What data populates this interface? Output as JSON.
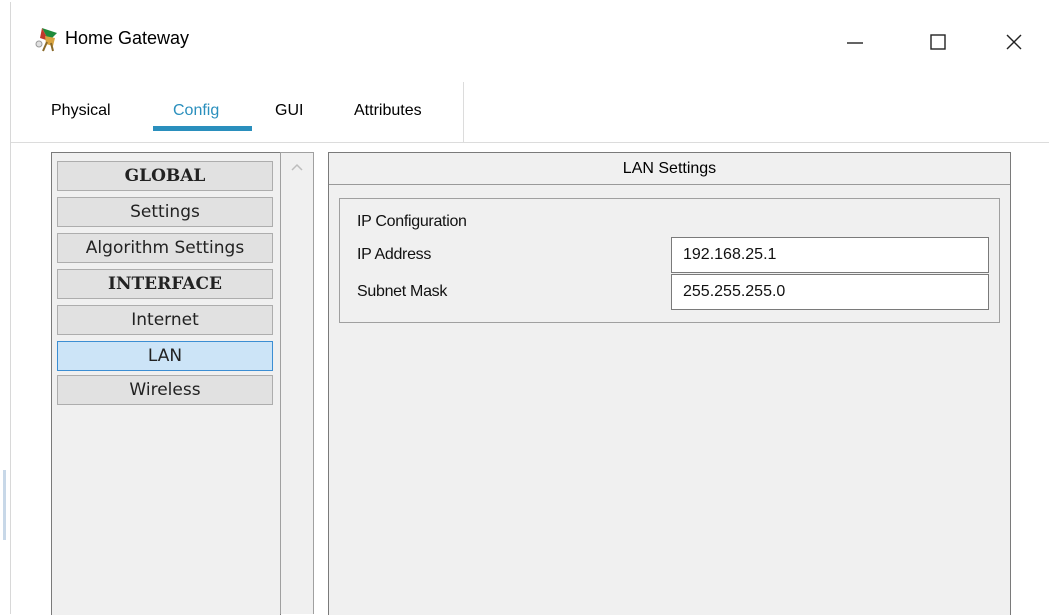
{
  "window": {
    "title": "Home Gateway",
    "icon": "home-gateway-icon"
  },
  "title_controls": {
    "minimize_glyph": "—",
    "maximize_glyph": "☐",
    "close_glyph": "✕"
  },
  "tabs": [
    {
      "label": "Physical"
    },
    {
      "label": "Config",
      "selected": true
    },
    {
      "label": "GUI"
    },
    {
      "label": "Attributes"
    }
  ],
  "nav": {
    "items": [
      {
        "label": "GLOBAL",
        "type": "header"
      },
      {
        "label": "Settings"
      },
      {
        "label": "Algorithm Settings"
      },
      {
        "label": "INTERFACE",
        "type": "header"
      },
      {
        "label": "Internet"
      },
      {
        "label": "LAN",
        "selected": true
      },
      {
        "label": "Wireless"
      }
    ]
  },
  "lan_settings": {
    "title": "LAN Settings",
    "group_label": "IP Configuration",
    "ip_label": "IP Address",
    "ip_value": "192.168.25.1",
    "mask_label": "Subnet Mask",
    "mask_value": "255.255.255.0"
  },
  "colors": {
    "accent": "#2a8fbd",
    "selected_bg": "#cce4f7",
    "selected_border": "#3c8ed3"
  }
}
